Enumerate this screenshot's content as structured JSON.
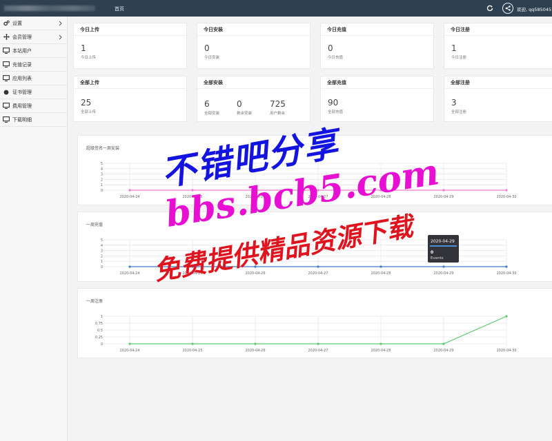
{
  "topbar": {
    "home_tab": "首页",
    "welcome_text": "欢迎, qq5850457 ▾",
    "icons": [
      "refresh-icon",
      "user-avatar-icon"
    ]
  },
  "sidebar": {
    "items": [
      {
        "label": "设置",
        "icon": "gears-icon",
        "has_arrow": true
      },
      {
        "label": "会员管理",
        "icon": "move-icon",
        "has_arrow": true
      },
      {
        "label": "本站用户",
        "icon": "monitor-icon",
        "has_arrow": false
      },
      {
        "label": "充值记录",
        "icon": "monitor-icon",
        "has_arrow": false
      },
      {
        "label": "应用列表",
        "icon": "monitor-icon",
        "has_arrow": false
      },
      {
        "label": "证书管理",
        "icon": "circle-icon",
        "has_arrow": false
      },
      {
        "label": "费用管理",
        "icon": "monitor-icon",
        "has_arrow": false
      },
      {
        "label": "下载明细",
        "icon": "monitor-icon",
        "has_arrow": false
      }
    ]
  },
  "today_cards": [
    {
      "title": "今日上传",
      "value": "1",
      "sub": "今日上传"
    },
    {
      "title": "今日安装",
      "value": "0",
      "sub": "今日安装"
    },
    {
      "title": "今日充值",
      "value": "0",
      "sub": "今日充值"
    },
    {
      "title": "今日注册",
      "value": "1",
      "sub": "今日注册"
    }
  ],
  "total_cards": {
    "upload": {
      "title": "全部上传",
      "value": "25",
      "sub": "全部上传"
    },
    "install": {
      "title": "全部安装",
      "stats": [
        {
          "value": "6",
          "sub": "全部安装"
        },
        {
          "value": "0",
          "sub": "剩余安装"
        },
        {
          "value": "725",
          "sub": "用户剩余"
        }
      ]
    },
    "recharge": {
      "title": "全部充值",
      "value": "90",
      "sub": "全部充值"
    },
    "register": {
      "title": "全部注册",
      "value": "3",
      "sub": "全部注册"
    }
  },
  "chart_data": [
    {
      "type": "line",
      "title": "超级签名一周安装",
      "x": [
        "2020-04-24",
        "2020-04-25",
        "2020-04-26",
        "2020-04-27",
        "2020-04-28",
        "2020-04-29",
        "2020-04-30"
      ],
      "yticks": [
        "0",
        "1",
        "2",
        "3",
        "4",
        "5"
      ],
      "ylim": [
        0,
        5
      ],
      "series": [
        {
          "values": [
            0,
            0,
            0,
            0,
            0,
            0,
            0
          ],
          "color": "#f27ad4"
        }
      ]
    },
    {
      "type": "line",
      "title": "一周充值",
      "x": [
        "2020-04-24",
        "2020-04-25",
        "2020-04-26",
        "2020-04-27",
        "2020-04-28",
        "2020-04-29",
        "2020-04-30"
      ],
      "yticks": [
        "0",
        "1",
        "2",
        "3",
        "4",
        "5"
      ],
      "ylim": [
        0,
        5
      ],
      "series": [
        {
          "values": [
            0,
            0,
            0,
            0,
            0,
            0,
            0
          ],
          "color": "#3d7ec0"
        }
      ],
      "tooltip": {
        "date": "2020-04-29",
        "value": "0",
        "label": "Events"
      }
    },
    {
      "type": "line",
      "title": "一周注册",
      "x": [
        "2020-04-24",
        "2020-04-25",
        "2020-04-26",
        "2020-04-27",
        "2020-04-28",
        "2020-04-29",
        "2020-04-30"
      ],
      "yticks": [
        "0",
        "0.25",
        "0.5",
        "0.75",
        "1"
      ],
      "ylim": [
        0,
        1
      ],
      "series": [
        {
          "values": [
            0,
            0,
            0,
            0,
            0,
            0,
            1
          ],
          "color": "#5cc96e"
        }
      ]
    }
  ],
  "watermark": {
    "line1": "不错吧分享",
    "line2": "bbs.bcb5.com",
    "line3": "免费提供精品资源下载"
  }
}
